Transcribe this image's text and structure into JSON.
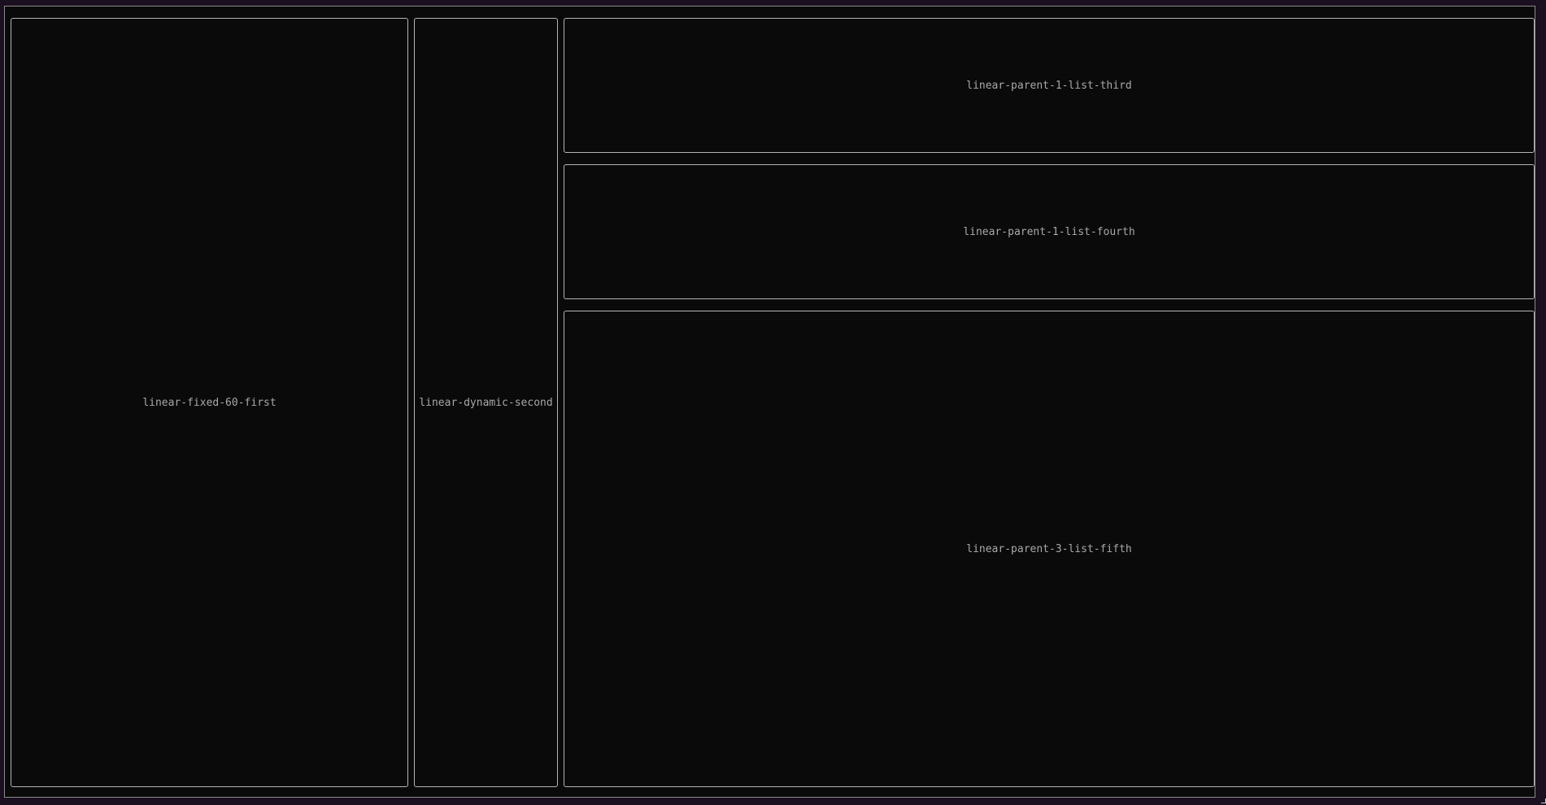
{
  "panes": {
    "first": {
      "label": "linear-fixed-60-first"
    },
    "second": {
      "label": "linear-dynamic-second"
    },
    "third": {
      "label": "linear-parent-1-list-third"
    },
    "fourth": {
      "label": "linear-parent-1-list-fourth"
    },
    "fifth": {
      "label": "linear-parent-3-list-fifth"
    }
  },
  "colors": {
    "background": "#0a0a0a",
    "border": "#b5b5b5",
    "text": "#a8a8a8"
  }
}
